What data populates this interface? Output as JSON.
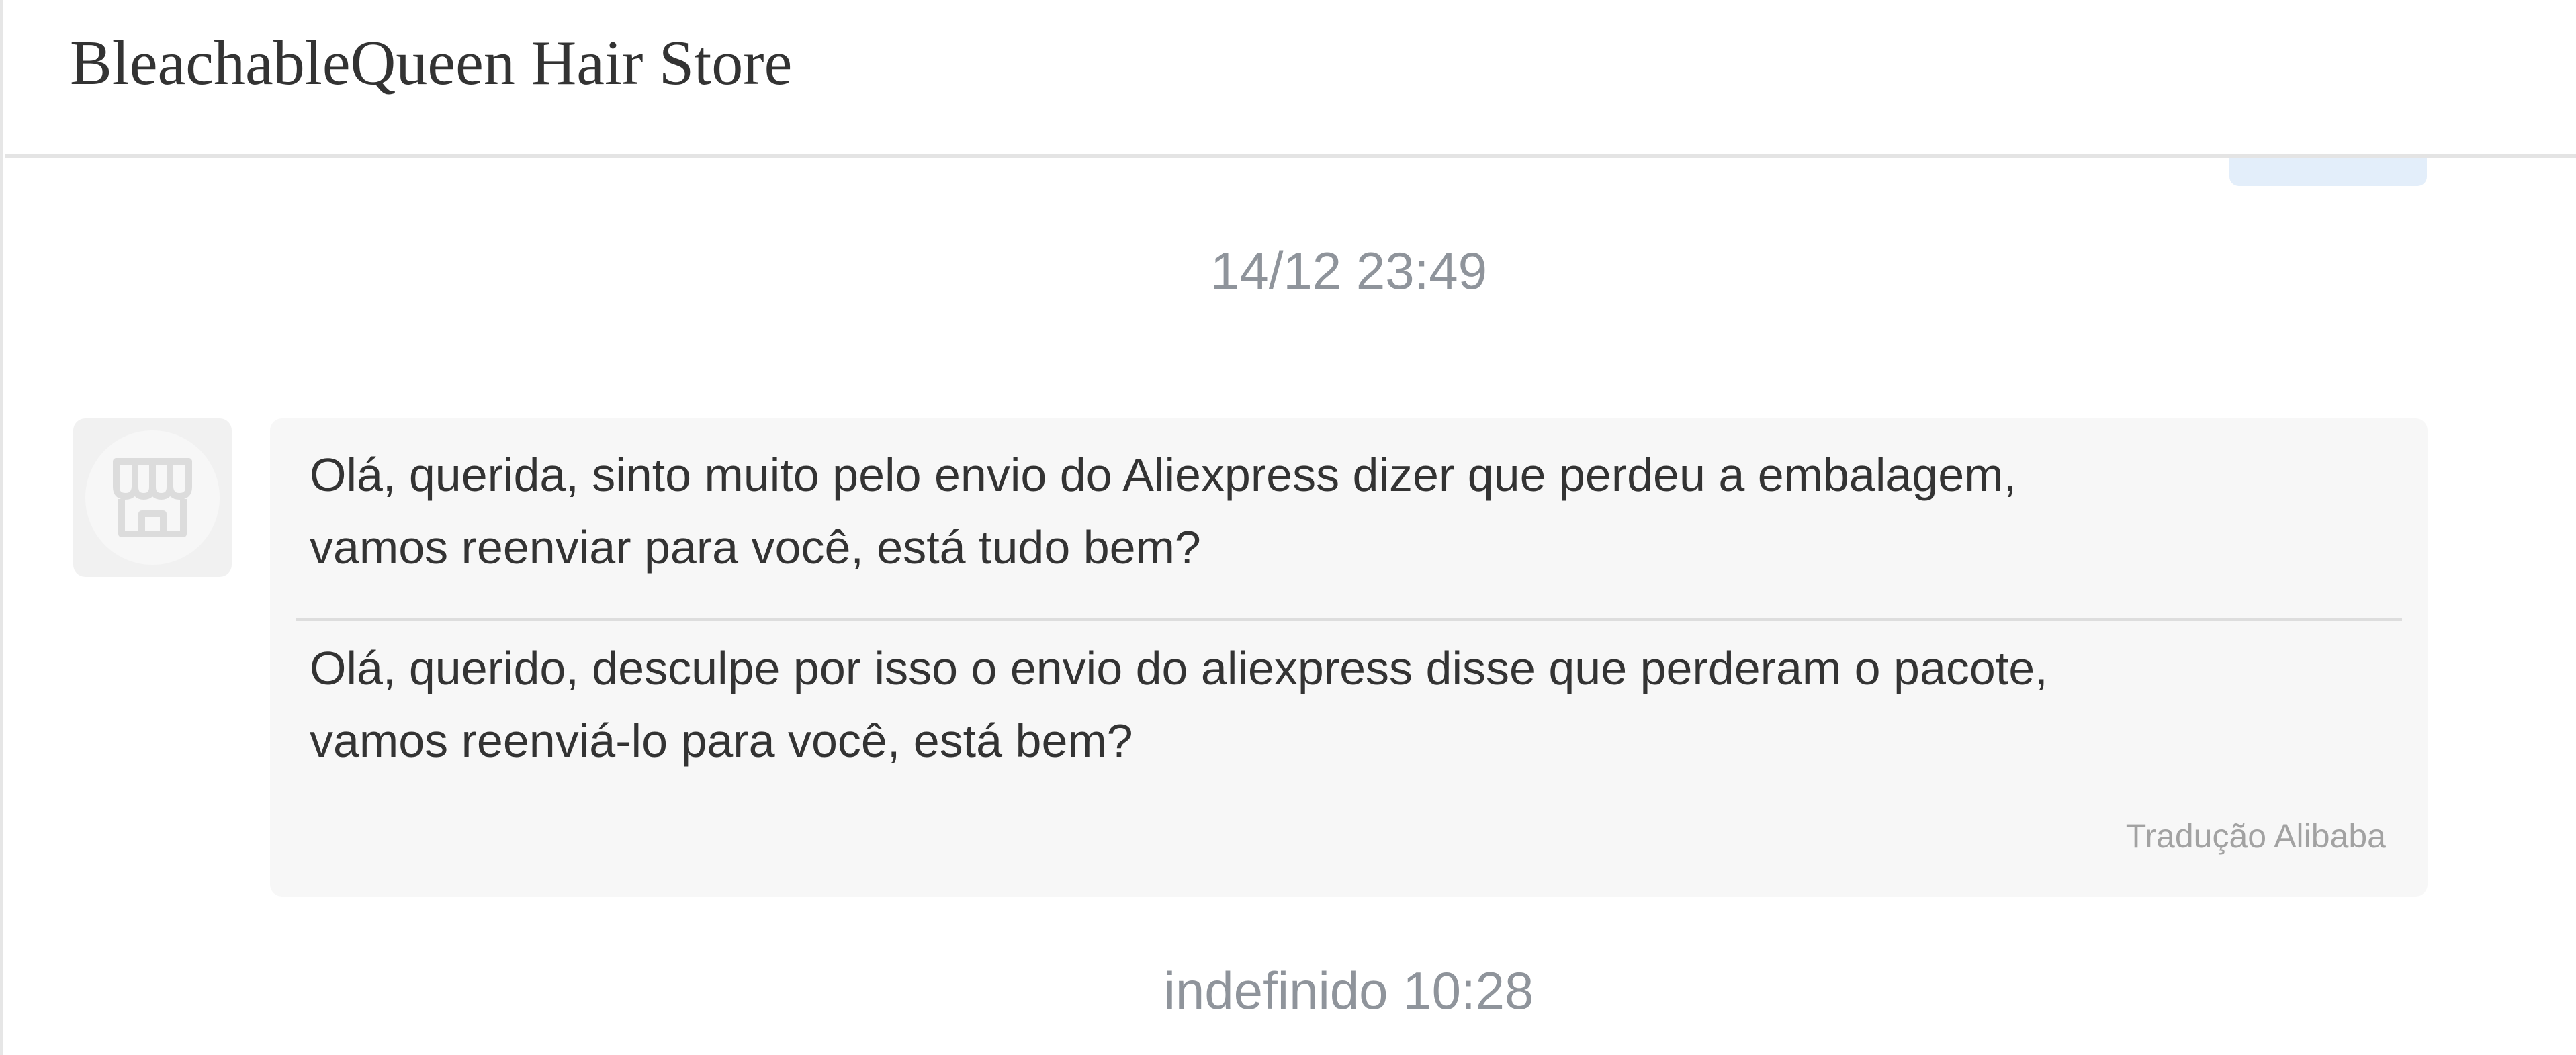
{
  "header": {
    "store_name": "BleachableQueen Hair Store"
  },
  "messages": {
    "timestamp_1": "14/12 23:49",
    "incoming": {
      "original_text": "Olá, querida, sinto muito pelo envio do Aliexpress dizer que perdeu a embalagem,\nvamos reenviar para você, está tudo bem?",
      "translated_text": "Olá, querido, desculpe por isso o envio do aliexpress disse que perderam o pacote,\nvamos reenviá-lo para você, está bem?",
      "translation_label": "Tradução Alibaba"
    },
    "timestamp_2": "indefinido 10:28"
  },
  "icons": {
    "avatar": "store-icon"
  },
  "colors": {
    "outgoing_bubble": "#e3eefa",
    "incoming_bubble": "#f7f7f7",
    "timestamp": "#8f949b"
  }
}
